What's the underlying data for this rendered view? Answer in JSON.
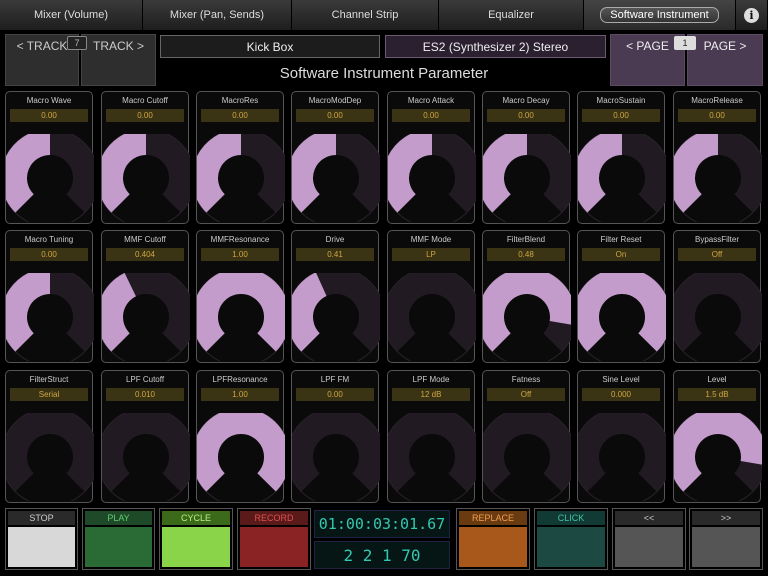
{
  "tabs": [
    {
      "label": "Mixer (Volume)"
    },
    {
      "label": "Mixer (Pan, Sends)"
    },
    {
      "label": "Channel Strip"
    },
    {
      "label": "Equalizer"
    },
    {
      "label": "Software Instrument",
      "active": true
    }
  ],
  "info_icon": "info-icon",
  "track_nav": {
    "prev_label": "< TRACK",
    "next_label": "TRACK >",
    "number": "7"
  },
  "track_name": "Kick Box",
  "instrument_name": "ES2  (Synthesizer 2) Stereo",
  "page_nav": {
    "prev_label": "< PAGE",
    "next_label": "PAGE >",
    "number": "1"
  },
  "page_title": "Software Instrument Parameter",
  "colors": {
    "knob_fill": "#c49ccc",
    "knob_track": "#221a22",
    "value_text": "#d0a640",
    "time_text": "#33c8b0"
  },
  "params": [
    {
      "name": "Macro Wave",
      "value": "0.00",
      "level": 0.5
    },
    {
      "name": "Macro Cutoff",
      "value": "0.00",
      "level": 0.5
    },
    {
      "name": "MacroRes",
      "value": "0.00",
      "level": 0.5
    },
    {
      "name": "MacroModDep",
      "value": "0.00",
      "level": 0.5
    },
    {
      "name": "Macro Attack",
      "value": "0.00",
      "level": 0.5
    },
    {
      "name": "Macro Decay",
      "value": "0.00",
      "level": 0.5
    },
    {
      "name": "MacroSustain",
      "value": "0.00",
      "level": 0.5
    },
    {
      "name": "MacroRelease",
      "value": "0.00",
      "level": 0.5
    },
    {
      "name": "Macro Tuning",
      "value": "0.00",
      "level": 0.5
    },
    {
      "name": "MMF Cutoff",
      "value": "0.404",
      "level": 0.404
    },
    {
      "name": "MMFResonance",
      "value": "1.00",
      "level": 1.0
    },
    {
      "name": "Drive",
      "value": "0.41",
      "level": 0.41
    },
    {
      "name": "MMF Mode",
      "value": "LP",
      "level": 0.0
    },
    {
      "name": "FilterBlend",
      "value": "0.48",
      "level": 0.87
    },
    {
      "name": "Filter Reset",
      "value": "On",
      "level": 1.0
    },
    {
      "name": "BypassFilter",
      "value": "Off",
      "level": 0.0
    },
    {
      "name": "FilterStruct",
      "value": "Serial",
      "level": 0.0
    },
    {
      "name": "LPF Cutoff",
      "value": "0.010",
      "level": 0.0
    },
    {
      "name": "LPFResonance",
      "value": "1.00",
      "level": 1.0
    },
    {
      "name": "LPF FM",
      "value": "0.00",
      "level": 0.0
    },
    {
      "name": "LPF Mode",
      "value": "12 dB",
      "level": 0.0
    },
    {
      "name": "Fatness",
      "value": "Off",
      "level": 0.0
    },
    {
      "name": "Sine Level",
      "value": "0.000",
      "level": 0.0
    },
    {
      "name": "Level",
      "value": "1.5 dB",
      "level": 0.87
    }
  ],
  "transport": {
    "stop": "STOP",
    "play": "PLAY",
    "cycle": "CYCLE",
    "record": "RECORD",
    "replace": "REPLACE",
    "click": "CLICK",
    "rewind": "<<",
    "forward": ">>",
    "time": "01:00:03:01.67",
    "position": "2  2  1  70"
  }
}
